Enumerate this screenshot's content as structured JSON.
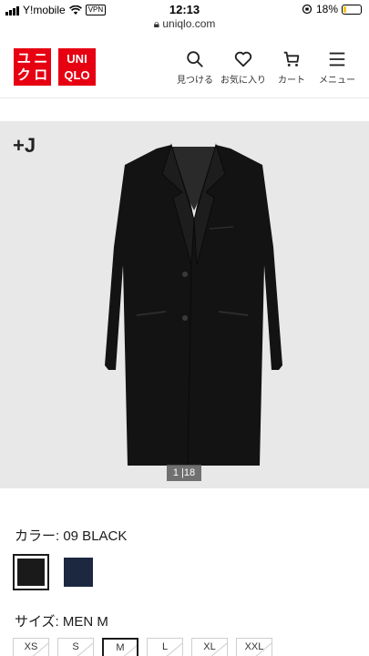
{
  "status_bar": {
    "carrier": "Y!mobile",
    "vpn": "VPN",
    "time": "12:13",
    "url": "uniqlo.com",
    "battery": "18%",
    "battery_level": 0.18,
    "battery_color": "#f5c518"
  },
  "header": {
    "logo_chars": [
      "ユ",
      "ニ",
      "ク",
      "ロ",
      "UNI",
      "QLO"
    ],
    "brand_color": "#e60012",
    "nav": [
      {
        "label": "見つける",
        "icon": "search-icon"
      },
      {
        "label": "お気に入り",
        "icon": "heart-icon"
      },
      {
        "label": "カート",
        "icon": "cart-icon"
      },
      {
        "label": "メニュー",
        "icon": "menu-icon"
      }
    ]
  },
  "product": {
    "badge": "+J",
    "image_counter_current": "1",
    "image_counter_total": "18",
    "color_label": "カラー: 09 BLACK",
    "colors": [
      {
        "name": "black",
        "hex": "#1a1a1a",
        "selected": true
      },
      {
        "name": "navy",
        "hex": "#1c2840",
        "selected": false
      }
    ],
    "size_label": "サイズ: MEN M",
    "sizes": [
      "XS",
      "S",
      "M",
      "L",
      "XL",
      "XXL"
    ],
    "selected_size": "M"
  }
}
